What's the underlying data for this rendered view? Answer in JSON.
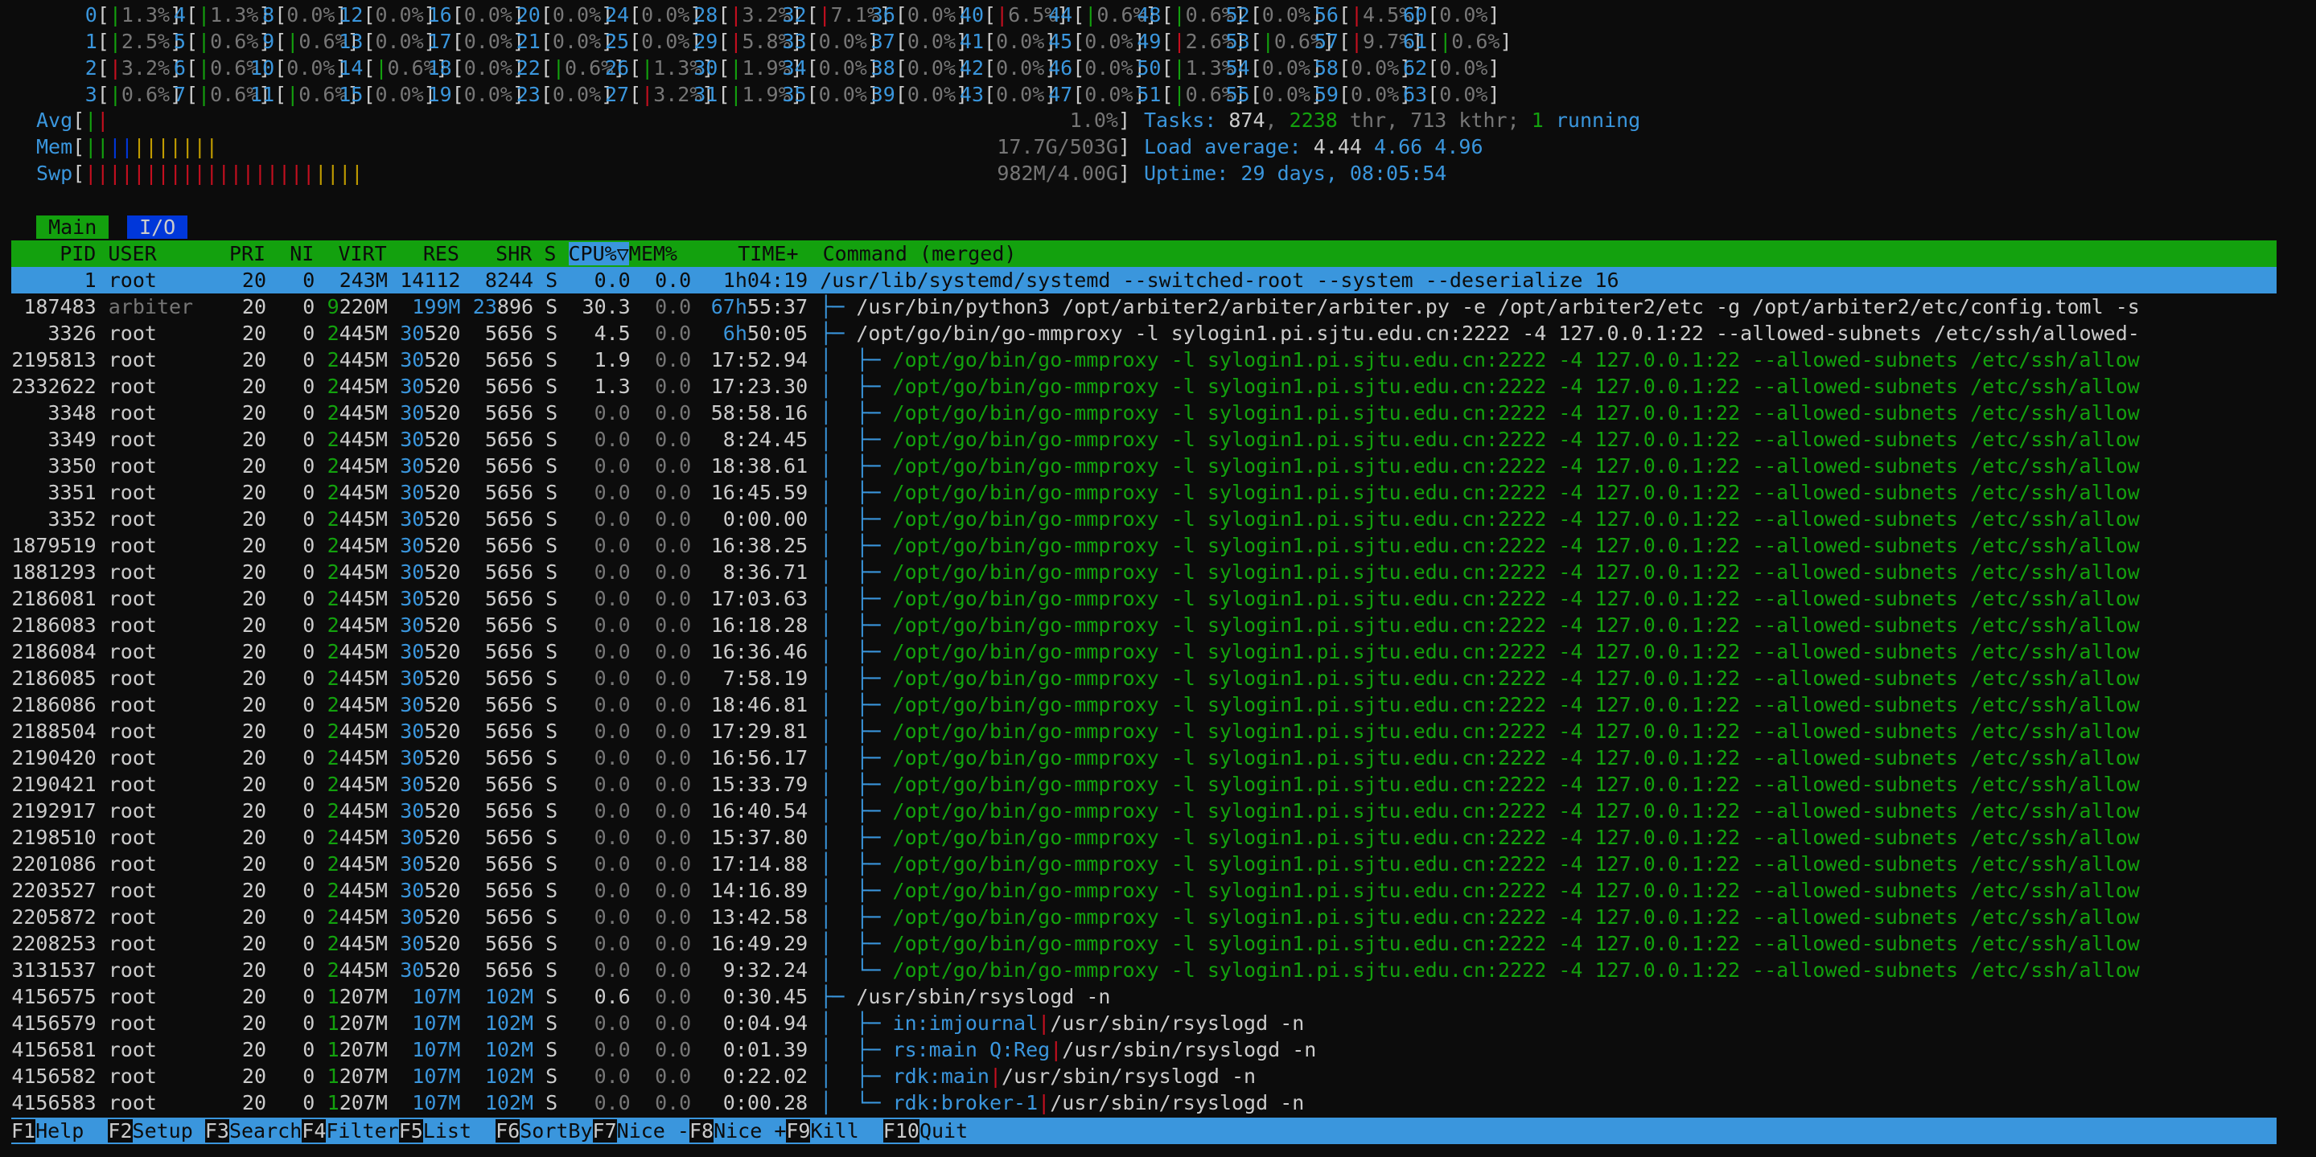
{
  "cpu_rows": [
    [
      [
        "0",
        "1.3%"
      ],
      [
        "4",
        "1.3%"
      ],
      [
        "8",
        "0.0%"
      ],
      [
        "12",
        "0.0%"
      ],
      [
        "16",
        "0.0%"
      ],
      [
        "20",
        "0.0%"
      ],
      [
        "24",
        "0.0%"
      ],
      [
        "28",
        "3.2%"
      ],
      [
        "32",
        "7.1%"
      ],
      [
        "36",
        "0.0%"
      ],
      [
        "40",
        "6.5%"
      ],
      [
        "44",
        "0.6%"
      ],
      [
        "48",
        "0.6%"
      ],
      [
        "52",
        "0.0%"
      ],
      [
        "56",
        "4.5%"
      ],
      [
        "60",
        "0.0%"
      ]
    ],
    [
      [
        "1",
        "2.5%"
      ],
      [
        "5",
        "0.6%"
      ],
      [
        "9",
        "0.6%"
      ],
      [
        "13",
        "0.0%"
      ],
      [
        "17",
        "0.0%"
      ],
      [
        "21",
        "0.0%"
      ],
      [
        "25",
        "0.0%"
      ],
      [
        "29",
        "5.8%"
      ],
      [
        "33",
        "0.0%"
      ],
      [
        "37",
        "0.0%"
      ],
      [
        "41",
        "0.0%"
      ],
      [
        "45",
        "0.0%"
      ],
      [
        "49",
        "2.6%"
      ],
      [
        "53",
        "0.6%"
      ],
      [
        "57",
        "9.7%"
      ],
      [
        "61",
        "0.6%"
      ]
    ],
    [
      [
        "2",
        "3.2%"
      ],
      [
        "6",
        "0.6%"
      ],
      [
        "10",
        "0.0%"
      ],
      [
        "14",
        "0.6%"
      ],
      [
        "18",
        "0.0%"
      ],
      [
        "22",
        "0.6%"
      ],
      [
        "26",
        "1.3%"
      ],
      [
        "30",
        "1.9%"
      ],
      [
        "34",
        "0.0%"
      ],
      [
        "38",
        "0.0%"
      ],
      [
        "42",
        "0.0%"
      ],
      [
        "46",
        "0.0%"
      ],
      [
        "50",
        "1.3%"
      ],
      [
        "54",
        "0.0%"
      ],
      [
        "58",
        "0.0%"
      ],
      [
        "62",
        "0.0%"
      ]
    ],
    [
      [
        "3",
        "0.6%"
      ],
      [
        "7",
        "0.6%"
      ],
      [
        "11",
        "0.6%"
      ],
      [
        "15",
        "0.0%"
      ],
      [
        "19",
        "0.0%"
      ],
      [
        "23",
        "0.0%"
      ],
      [
        "27",
        "3.2%"
      ],
      [
        "31",
        "1.9%"
      ],
      [
        "35",
        "0.0%"
      ],
      [
        "39",
        "0.0%"
      ],
      [
        "43",
        "0.0%"
      ],
      [
        "47",
        "0.0%"
      ],
      [
        "51",
        "0.6%"
      ],
      [
        "55",
        "0.0%"
      ],
      [
        "59",
        "0.0%"
      ],
      [
        "63",
        "0.0%"
      ]
    ]
  ],
  "meters": {
    "avg_label": "Avg",
    "avg_value": "1.0%",
    "mem_label": "Mem",
    "mem_value": "17.7G/503G",
    "swp_label": "Swp",
    "swp_value": "982M/4.00G"
  },
  "stats": {
    "tasks_label": "Tasks:",
    "tasks": "874",
    "thr": "2238",
    "thr_label": "thr",
    "kthr": "713",
    "kthr_label": "kthr;",
    "running": "1",
    "running_label": "running",
    "load_label": "Load average:",
    "load1": "4.44",
    "load5": "4.66",
    "load15": "4.96",
    "uptime_label": "Uptime:",
    "uptime": "29 days, 08:05:54"
  },
  "tabs": {
    "main": "Main",
    "io": "I/O"
  },
  "columns": {
    "pid": "PID",
    "user": "USER",
    "pri": "PRI",
    "ni": "NI",
    "virt": "VIRT",
    "res": "RES",
    "shr": "SHR",
    "s": "S",
    "cpu": "CPU%▽",
    "mem": "MEM%",
    "time": "TIME+",
    "cmd": "Command (merged)"
  },
  "processes": [
    {
      "pid": "1",
      "user": "root",
      "pri": "20",
      "ni": "0",
      "virt": "243M",
      "res": "14112",
      "shr": "8244",
      "s": "S",
      "cpu": "0.0",
      "mem": "0.0",
      "time": "1h04:19",
      "tree": "",
      "cmd": "/usr/lib/systemd/systemd --switched-root --system --deserialize 16",
      "selected": true
    },
    {
      "pid": "187483",
      "user": "arbiter",
      "pri": "20",
      "ni": "0",
      "virt": "9220M",
      "res": "199M",
      "shr": "23896",
      "s": "S",
      "cpu": "30.3",
      "mem": "0.0",
      "time": "67h55:37",
      "tree": "├─ ",
      "cmd": "/usr/bin/python3 /opt/arbiter2/arbiter/arbiter.py -e /opt/arbiter2/etc -g /opt/arbiter2/etc/config.toml -s"
    },
    {
      "pid": "3326",
      "user": "root",
      "pri": "20",
      "ni": "0",
      "virt": "2445M",
      "res": "30520",
      "shr": "5656",
      "s": "S",
      "cpu": "4.5",
      "mem": "0.0",
      "time": "6h50:05",
      "tree": "├─ ",
      "cmd": "/opt/go/bin/go-mmproxy -l sylogin1.pi.sjtu.edu.cn:2222 -4 127.0.0.1:22 --allowed-subnets /etc/ssh/allowed-"
    },
    {
      "pid": "2195813",
      "user": "root",
      "pri": "20",
      "ni": "0",
      "virt": "2445M",
      "res": "30520",
      "shr": "5656",
      "s": "S",
      "cpu": "1.9",
      "mem": "0.0",
      "time": "17:52.94",
      "tree": "│  ├─ ",
      "cmd": "/opt/go/bin/go-mmproxy -l sylogin1.pi.sjtu.edu.cn:2222 -4 127.0.0.1:22 --allowed-subnets /etc/ssh/allow",
      "thread": true
    },
    {
      "pid": "2332622",
      "user": "root",
      "pri": "20",
      "ni": "0",
      "virt": "2445M",
      "res": "30520",
      "shr": "5656",
      "s": "S",
      "cpu": "1.3",
      "mem": "0.0",
      "time": "17:23.30",
      "tree": "│  ├─ ",
      "cmd": "/opt/go/bin/go-mmproxy -l sylogin1.pi.sjtu.edu.cn:2222 -4 127.0.0.1:22 --allowed-subnets /etc/ssh/allow",
      "thread": true
    },
    {
      "pid": "3348",
      "user": "root",
      "pri": "20",
      "ni": "0",
      "virt": "2445M",
      "res": "30520",
      "shr": "5656",
      "s": "S",
      "cpu": "0.0",
      "mem": "0.0",
      "time": "58:58.16",
      "tree": "│  ├─ ",
      "cmd": "/opt/go/bin/go-mmproxy -l sylogin1.pi.sjtu.edu.cn:2222 -4 127.0.0.1:22 --allowed-subnets /etc/ssh/allow",
      "thread": true
    },
    {
      "pid": "3349",
      "user": "root",
      "pri": "20",
      "ni": "0",
      "virt": "2445M",
      "res": "30520",
      "shr": "5656",
      "s": "S",
      "cpu": "0.0",
      "mem": "0.0",
      "time": "8:24.45",
      "tree": "│  ├─ ",
      "cmd": "/opt/go/bin/go-mmproxy -l sylogin1.pi.sjtu.edu.cn:2222 -4 127.0.0.1:22 --allowed-subnets /etc/ssh/allow",
      "thread": true
    },
    {
      "pid": "3350",
      "user": "root",
      "pri": "20",
      "ni": "0",
      "virt": "2445M",
      "res": "30520",
      "shr": "5656",
      "s": "S",
      "cpu": "0.0",
      "mem": "0.0",
      "time": "18:38.61",
      "tree": "│  ├─ ",
      "cmd": "/opt/go/bin/go-mmproxy -l sylogin1.pi.sjtu.edu.cn:2222 -4 127.0.0.1:22 --allowed-subnets /etc/ssh/allow",
      "thread": true
    },
    {
      "pid": "3351",
      "user": "root",
      "pri": "20",
      "ni": "0",
      "virt": "2445M",
      "res": "30520",
      "shr": "5656",
      "s": "S",
      "cpu": "0.0",
      "mem": "0.0",
      "time": "16:45.59",
      "tree": "│  ├─ ",
      "cmd": "/opt/go/bin/go-mmproxy -l sylogin1.pi.sjtu.edu.cn:2222 -4 127.0.0.1:22 --allowed-subnets /etc/ssh/allow",
      "thread": true
    },
    {
      "pid": "3352",
      "user": "root",
      "pri": "20",
      "ni": "0",
      "virt": "2445M",
      "res": "30520",
      "shr": "5656",
      "s": "S",
      "cpu": "0.0",
      "mem": "0.0",
      "time": "0:00.00",
      "tree": "│  ├─ ",
      "cmd": "/opt/go/bin/go-mmproxy -l sylogin1.pi.sjtu.edu.cn:2222 -4 127.0.0.1:22 --allowed-subnets /etc/ssh/allow",
      "thread": true
    },
    {
      "pid": "1879519",
      "user": "root",
      "pri": "20",
      "ni": "0",
      "virt": "2445M",
      "res": "30520",
      "shr": "5656",
      "s": "S",
      "cpu": "0.0",
      "mem": "0.0",
      "time": "16:38.25",
      "tree": "│  ├─ ",
      "cmd": "/opt/go/bin/go-mmproxy -l sylogin1.pi.sjtu.edu.cn:2222 -4 127.0.0.1:22 --allowed-subnets /etc/ssh/allow",
      "thread": true
    },
    {
      "pid": "1881293",
      "user": "root",
      "pri": "20",
      "ni": "0",
      "virt": "2445M",
      "res": "30520",
      "shr": "5656",
      "s": "S",
      "cpu": "0.0",
      "mem": "0.0",
      "time": "8:36.71",
      "tree": "│  ├─ ",
      "cmd": "/opt/go/bin/go-mmproxy -l sylogin1.pi.sjtu.edu.cn:2222 -4 127.0.0.1:22 --allowed-subnets /etc/ssh/allow",
      "thread": true
    },
    {
      "pid": "2186081",
      "user": "root",
      "pri": "20",
      "ni": "0",
      "virt": "2445M",
      "res": "30520",
      "shr": "5656",
      "s": "S",
      "cpu": "0.0",
      "mem": "0.0",
      "time": "17:03.63",
      "tree": "│  ├─ ",
      "cmd": "/opt/go/bin/go-mmproxy -l sylogin1.pi.sjtu.edu.cn:2222 -4 127.0.0.1:22 --allowed-subnets /etc/ssh/allow",
      "thread": true
    },
    {
      "pid": "2186083",
      "user": "root",
      "pri": "20",
      "ni": "0",
      "virt": "2445M",
      "res": "30520",
      "shr": "5656",
      "s": "S",
      "cpu": "0.0",
      "mem": "0.0",
      "time": "16:18.28",
      "tree": "│  ├─ ",
      "cmd": "/opt/go/bin/go-mmproxy -l sylogin1.pi.sjtu.edu.cn:2222 -4 127.0.0.1:22 --allowed-subnets /etc/ssh/allow",
      "thread": true
    },
    {
      "pid": "2186084",
      "user": "root",
      "pri": "20",
      "ni": "0",
      "virt": "2445M",
      "res": "30520",
      "shr": "5656",
      "s": "S",
      "cpu": "0.0",
      "mem": "0.0",
      "time": "16:36.46",
      "tree": "│  ├─ ",
      "cmd": "/opt/go/bin/go-mmproxy -l sylogin1.pi.sjtu.edu.cn:2222 -4 127.0.0.1:22 --allowed-subnets /etc/ssh/allow",
      "thread": true
    },
    {
      "pid": "2186085",
      "user": "root",
      "pri": "20",
      "ni": "0",
      "virt": "2445M",
      "res": "30520",
      "shr": "5656",
      "s": "S",
      "cpu": "0.0",
      "mem": "0.0",
      "time": "7:58.19",
      "tree": "│  ├─ ",
      "cmd": "/opt/go/bin/go-mmproxy -l sylogin1.pi.sjtu.edu.cn:2222 -4 127.0.0.1:22 --allowed-subnets /etc/ssh/allow",
      "thread": true
    },
    {
      "pid": "2186086",
      "user": "root",
      "pri": "20",
      "ni": "0",
      "virt": "2445M",
      "res": "30520",
      "shr": "5656",
      "s": "S",
      "cpu": "0.0",
      "mem": "0.0",
      "time": "18:46.81",
      "tree": "│  ├─ ",
      "cmd": "/opt/go/bin/go-mmproxy -l sylogin1.pi.sjtu.edu.cn:2222 -4 127.0.0.1:22 --allowed-subnets /etc/ssh/allow",
      "thread": true
    },
    {
      "pid": "2188504",
      "user": "root",
      "pri": "20",
      "ni": "0",
      "virt": "2445M",
      "res": "30520",
      "shr": "5656",
      "s": "S",
      "cpu": "0.0",
      "mem": "0.0",
      "time": "17:29.81",
      "tree": "│  ├─ ",
      "cmd": "/opt/go/bin/go-mmproxy -l sylogin1.pi.sjtu.edu.cn:2222 -4 127.0.0.1:22 --allowed-subnets /etc/ssh/allow",
      "thread": true
    },
    {
      "pid": "2190420",
      "user": "root",
      "pri": "20",
      "ni": "0",
      "virt": "2445M",
      "res": "30520",
      "shr": "5656",
      "s": "S",
      "cpu": "0.0",
      "mem": "0.0",
      "time": "16:56.17",
      "tree": "│  ├─ ",
      "cmd": "/opt/go/bin/go-mmproxy -l sylogin1.pi.sjtu.edu.cn:2222 -4 127.0.0.1:22 --allowed-subnets /etc/ssh/allow",
      "thread": true
    },
    {
      "pid": "2190421",
      "user": "root",
      "pri": "20",
      "ni": "0",
      "virt": "2445M",
      "res": "30520",
      "shr": "5656",
      "s": "S",
      "cpu": "0.0",
      "mem": "0.0",
      "time": "15:33.79",
      "tree": "│  ├─ ",
      "cmd": "/opt/go/bin/go-mmproxy -l sylogin1.pi.sjtu.edu.cn:2222 -4 127.0.0.1:22 --allowed-subnets /etc/ssh/allow",
      "thread": true
    },
    {
      "pid": "2192917",
      "user": "root",
      "pri": "20",
      "ni": "0",
      "virt": "2445M",
      "res": "30520",
      "shr": "5656",
      "s": "S",
      "cpu": "0.0",
      "mem": "0.0",
      "time": "16:40.54",
      "tree": "│  ├─ ",
      "cmd": "/opt/go/bin/go-mmproxy -l sylogin1.pi.sjtu.edu.cn:2222 -4 127.0.0.1:22 --allowed-subnets /etc/ssh/allow",
      "thread": true
    },
    {
      "pid": "2198510",
      "user": "root",
      "pri": "20",
      "ni": "0",
      "virt": "2445M",
      "res": "30520",
      "shr": "5656",
      "s": "S",
      "cpu": "0.0",
      "mem": "0.0",
      "time": "15:37.80",
      "tree": "│  ├─ ",
      "cmd": "/opt/go/bin/go-mmproxy -l sylogin1.pi.sjtu.edu.cn:2222 -4 127.0.0.1:22 --allowed-subnets /etc/ssh/allow",
      "thread": true
    },
    {
      "pid": "2201086",
      "user": "root",
      "pri": "20",
      "ni": "0",
      "virt": "2445M",
      "res": "30520",
      "shr": "5656",
      "s": "S",
      "cpu": "0.0",
      "mem": "0.0",
      "time": "17:14.88",
      "tree": "│  ├─ ",
      "cmd": "/opt/go/bin/go-mmproxy -l sylogin1.pi.sjtu.edu.cn:2222 -4 127.0.0.1:22 --allowed-subnets /etc/ssh/allow",
      "thread": true
    },
    {
      "pid": "2203527",
      "user": "root",
      "pri": "20",
      "ni": "0",
      "virt": "2445M",
      "res": "30520",
      "shr": "5656",
      "s": "S",
      "cpu": "0.0",
      "mem": "0.0",
      "time": "14:16.89",
      "tree": "│  ├─ ",
      "cmd": "/opt/go/bin/go-mmproxy -l sylogin1.pi.sjtu.edu.cn:2222 -4 127.0.0.1:22 --allowed-subnets /etc/ssh/allow",
      "thread": true
    },
    {
      "pid": "2205872",
      "user": "root",
      "pri": "20",
      "ni": "0",
      "virt": "2445M",
      "res": "30520",
      "shr": "5656",
      "s": "S",
      "cpu": "0.0",
      "mem": "0.0",
      "time": "13:42.58",
      "tree": "│  ├─ ",
      "cmd": "/opt/go/bin/go-mmproxy -l sylogin1.pi.sjtu.edu.cn:2222 -4 127.0.0.1:22 --allowed-subnets /etc/ssh/allow",
      "thread": true
    },
    {
      "pid": "2208253",
      "user": "root",
      "pri": "20",
      "ni": "0",
      "virt": "2445M",
      "res": "30520",
      "shr": "5656",
      "s": "S",
      "cpu": "0.0",
      "mem": "0.0",
      "time": "16:49.29",
      "tree": "│  ├─ ",
      "cmd": "/opt/go/bin/go-mmproxy -l sylogin1.pi.sjtu.edu.cn:2222 -4 127.0.0.1:22 --allowed-subnets /etc/ssh/allow",
      "thread": true
    },
    {
      "pid": "3131537",
      "user": "root",
      "pri": "20",
      "ni": "0",
      "virt": "2445M",
      "res": "30520",
      "shr": "5656",
      "s": "S",
      "cpu": "0.0",
      "mem": "0.0",
      "time": "9:32.24",
      "tree": "│  └─ ",
      "cmd": "/opt/go/bin/go-mmproxy -l sylogin1.pi.sjtu.edu.cn:2222 -4 127.0.0.1:22 --allowed-subnets /etc/ssh/allow",
      "thread": true
    },
    {
      "pid": "4156575",
      "user": "root",
      "pri": "20",
      "ni": "0",
      "virt": "1207M",
      "res": "107M",
      "shr": "102M",
      "s": "S",
      "cpu": "0.6",
      "mem": "0.0",
      "time": "0:30.45",
      "tree": "├─ ",
      "cmd": "/usr/sbin/rsyslogd -n"
    },
    {
      "pid": "4156579",
      "user": "root",
      "pri": "20",
      "ni": "0",
      "virt": "1207M",
      "res": "107M",
      "shr": "102M",
      "s": "S",
      "cpu": "0.0",
      "mem": "0.0",
      "time": "0:04.94",
      "tree": "│  ├─ ",
      "tname": "in:imjournal",
      "cmd": "/usr/sbin/rsyslogd -n"
    },
    {
      "pid": "4156581",
      "user": "root",
      "pri": "20",
      "ni": "0",
      "virt": "1207M",
      "res": "107M",
      "shr": "102M",
      "s": "S",
      "cpu": "0.0",
      "mem": "0.0",
      "time": "0:01.39",
      "tree": "│  ├─ ",
      "tname": "rs:main Q:Reg",
      "cmd": "/usr/sbin/rsyslogd -n"
    },
    {
      "pid": "4156582",
      "user": "root",
      "pri": "20",
      "ni": "0",
      "virt": "1207M",
      "res": "107M",
      "shr": "102M",
      "s": "S",
      "cpu": "0.0",
      "mem": "0.0",
      "time": "0:22.02",
      "tree": "│  ├─ ",
      "tname": "rdk:main",
      "cmd": "/usr/sbin/rsyslogd -n"
    },
    {
      "pid": "4156583",
      "user": "root",
      "pri": "20",
      "ni": "0",
      "virt": "1207M",
      "res": "107M",
      "shr": "102M",
      "s": "S",
      "cpu": "0.0",
      "mem": "0.0",
      "time": "0:00.28",
      "tree": "│  └─ ",
      "tname": "rdk:broker-1",
      "cmd": "/usr/sbin/rsyslogd -n"
    }
  ],
  "fkeys": [
    {
      "key": "F1",
      "label": "Help  "
    },
    {
      "key": "F2",
      "label": "Setup "
    },
    {
      "key": "F3",
      "label": "Search"
    },
    {
      "key": "F4",
      "label": "Filter"
    },
    {
      "key": "F5",
      "label": "List  "
    },
    {
      "key": "F6",
      "label": "SortBy"
    },
    {
      "key": "F7",
      "label": "Nice -"
    },
    {
      "key": "F8",
      "label": "Nice +"
    },
    {
      "key": "F9",
      "label": "Kill  "
    },
    {
      "key": "F10",
      "label": "Quit"
    }
  ],
  "colors": {
    "green": "#13a10e",
    "red": "#c50f1f",
    "blue": "#3a96dd",
    "darkblue": "#0037da",
    "yellow": "#c19c00",
    "bg": "#0c0c0c"
  }
}
